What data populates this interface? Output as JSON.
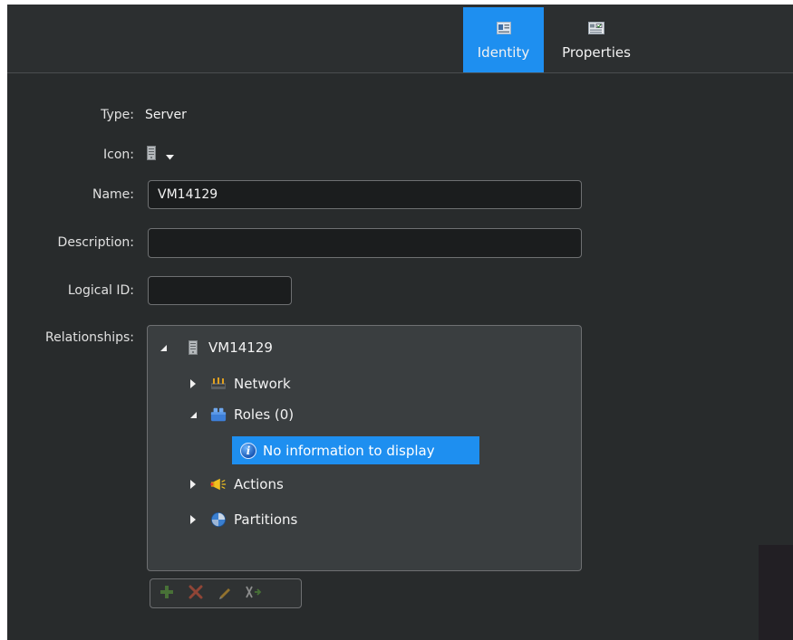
{
  "tabs": [
    {
      "label": "Identity",
      "icon": "identity-card-icon",
      "active": true
    },
    {
      "label": "Properties",
      "icon": "properties-list-icon",
      "active": false
    }
  ],
  "form": {
    "type_label": "Type:",
    "type_value": "Server",
    "icon_label": "Icon:",
    "icon_value": "server-icon",
    "name_label": "Name:",
    "name_value": "VM14129",
    "description_label": "Description:",
    "description_value": "",
    "logical_id_label": "Logical ID:",
    "logical_id_value": "",
    "relationships_label": "Relationships:"
  },
  "tree": {
    "root": {
      "label": "VM14129",
      "icon": "server-icon",
      "expanded": true
    },
    "children": [
      {
        "label": "Network",
        "icon": "network-icon",
        "expanded": false
      },
      {
        "label": "Roles (0)",
        "icon": "roles-icon",
        "expanded": true
      },
      {
        "label": "Actions",
        "icon": "actions-icon",
        "expanded": false
      },
      {
        "label": "Partitions",
        "icon": "partitions-icon",
        "expanded": false
      }
    ],
    "info_message": "No information to display"
  },
  "toolbar": [
    "add-icon",
    "delete-icon",
    "edit-icon",
    "remove-link-icon"
  ],
  "colors": {
    "background": "#282b2c",
    "accent": "#1e8ff0",
    "tree_background": "#3a3e40"
  }
}
